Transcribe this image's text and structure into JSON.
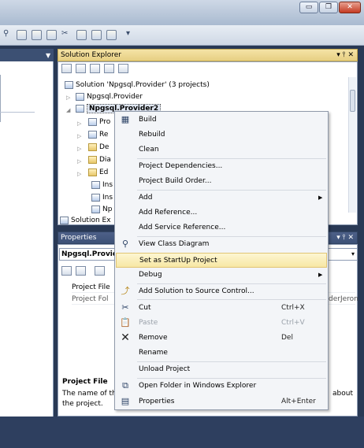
{
  "titlebar": {
    "buttons": [
      {
        "name": "minimize-button",
        "glyph": "▭"
      },
      {
        "name": "maximize-button",
        "glyph": "❐"
      },
      {
        "name": "close-button",
        "glyph": "✕"
      }
    ]
  },
  "toolbar": {
    "overflow": "▾",
    "icons": [
      "attach-icon",
      "settings-icon",
      "window-icon",
      "layout-icon",
      "tool-icon",
      "solution-icon",
      "project-icon",
      "dropdown-icon"
    ]
  },
  "document": {
    "tab_arrow": "▼"
  },
  "solution_explorer": {
    "title": "Solution Explorer",
    "pins": "▾ ⫯ ✕",
    "tree": [
      {
        "label": "Solution 'Npgsql.Provider' (3 projects)",
        "icon": "solution-icon"
      },
      {
        "label": "Npgsql.Provider",
        "icon": "csharp-project-icon",
        "expander": "▷"
      },
      {
        "label": "Npgsql.Provider2",
        "icon": "csharp-project-icon",
        "expander": "◢",
        "selected": true
      },
      {
        "label": "Pro",
        "icon": "properties-icon",
        "expander": "▷"
      },
      {
        "label": "Re",
        "icon": "references-icon",
        "expander": "▷"
      },
      {
        "label": "De",
        "icon": "folder-icon",
        "expander": "▷"
      },
      {
        "label": "Dia",
        "icon": "folder-icon",
        "expander": "▷"
      },
      {
        "label": "Ed",
        "icon": "folder-icon",
        "expander": "▷"
      },
      {
        "label": "Ins",
        "icon": "file-icon"
      },
      {
        "label": "Ins",
        "icon": "file-icon"
      },
      {
        "label": "Np",
        "icon": "file-icon"
      }
    ],
    "bottom_tab": "Solution Ex"
  },
  "properties": {
    "title": "Properties",
    "pins": "▾ ⫯ ✕",
    "combo_value": "Npgsql.Provide",
    "rows": [
      {
        "name": "Project File",
        "value": ""
      },
      {
        "name": "Project Fol",
        "value": "derJeron"
      }
    ],
    "desc_title": "Project File",
    "desc_text_1": "The name of th",
    "desc_text_2": "the project.",
    "desc_text_right": "about"
  },
  "context_menu": {
    "items": [
      {
        "id": "build",
        "label": "Build",
        "icon": "build-icon",
        "shortcut": "",
        "arrow": false
      },
      {
        "id": "rebuild",
        "label": "Rebuild",
        "icon": "",
        "shortcut": "",
        "arrow": false
      },
      {
        "id": "clean",
        "label": "Clean",
        "icon": "",
        "shortcut": "",
        "arrow": false
      },
      {
        "id": "project-dependencies",
        "label": "Project Dependencies...",
        "icon": "",
        "shortcut": "",
        "arrow": false
      },
      {
        "id": "project-build-order",
        "label": "Project Build Order...",
        "icon": "",
        "shortcut": "",
        "arrow": false
      },
      {
        "id": "add",
        "label": "Add",
        "icon": "",
        "shortcut": "",
        "arrow": true
      },
      {
        "id": "add-reference",
        "label": "Add Reference...",
        "icon": "",
        "shortcut": "",
        "arrow": false
      },
      {
        "id": "add-service-reference",
        "label": "Add Service Reference...",
        "icon": "",
        "shortcut": "",
        "arrow": false
      },
      {
        "id": "view-class-diagram",
        "label": "View Class Diagram",
        "icon": "class-diagram-icon",
        "shortcut": "",
        "arrow": false
      },
      {
        "id": "set-startup",
        "label": "Set as StartUp Project",
        "icon": "",
        "shortcut": "",
        "arrow": false,
        "highlighted": true
      },
      {
        "id": "debug",
        "label": "Debug",
        "icon": "",
        "shortcut": "",
        "arrow": true
      },
      {
        "id": "add-source-control",
        "label": "Add Solution to Source Control...",
        "icon": "source-control-icon",
        "shortcut": "",
        "arrow": false
      },
      {
        "id": "cut",
        "label": "Cut",
        "icon": "cut-icon",
        "shortcut": "Ctrl+X",
        "arrow": false
      },
      {
        "id": "paste",
        "label": "Paste",
        "icon": "paste-icon",
        "shortcut": "Ctrl+V",
        "arrow": false,
        "disabled": true
      },
      {
        "id": "remove",
        "label": "Remove",
        "icon": "remove-icon",
        "shortcut": "Del",
        "arrow": false
      },
      {
        "id": "rename",
        "label": "Rename",
        "icon": "",
        "shortcut": "",
        "arrow": false
      },
      {
        "id": "unload-project",
        "label": "Unload Project",
        "icon": "",
        "shortcut": "",
        "arrow": false
      },
      {
        "id": "open-folder",
        "label": "Open Folder in Windows Explorer",
        "icon": "open-folder-icon",
        "shortcut": "",
        "arrow": false
      },
      {
        "id": "properties",
        "label": "Properties",
        "icon": "properties-icon",
        "shortcut": "Alt+Enter",
        "arrow": false
      }
    ]
  },
  "colors": {
    "ide_background": "#293955",
    "menu_highlight": "#f7e7a4",
    "panel_header": "#e7cf82",
    "panel_header_blue": "#3d5277"
  }
}
